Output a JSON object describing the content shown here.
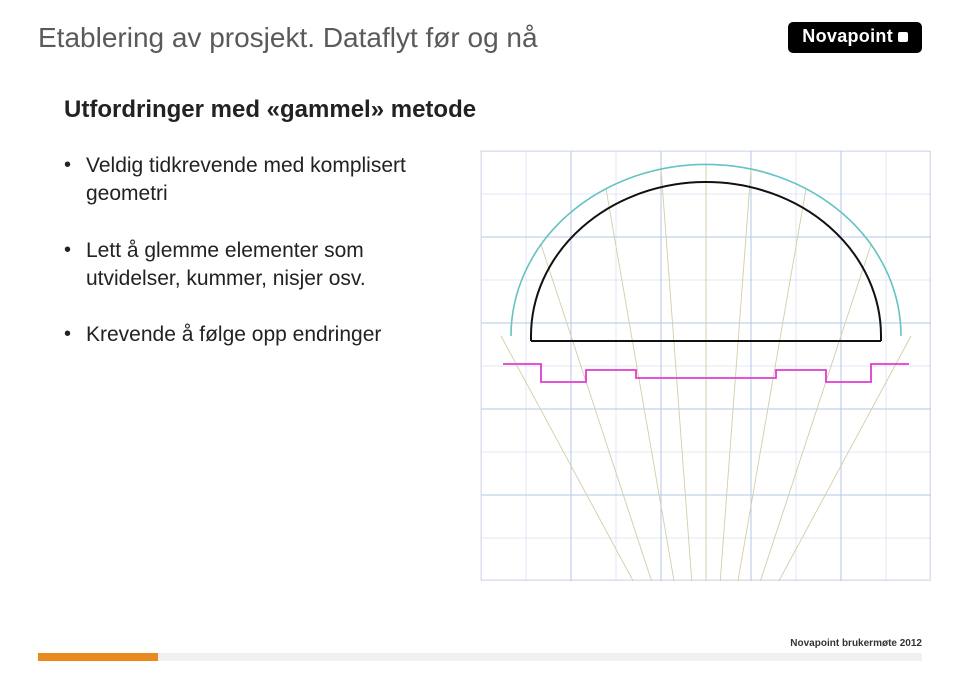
{
  "header": {
    "title": "Etablering av prosjekt. Dataflyt før og nå",
    "logo_text": "Novapoint"
  },
  "subtitle": "Utfordringer med «gammel» metode",
  "bullets": [
    "Veldig tidkrevende med komplisert geometri",
    "Lett å glemme elementer som utvidelser, kummer, nisjer osv.",
    "Krevende å følge opp endringer"
  ],
  "footer": {
    "text": "Novapoint brukermøte 2012"
  },
  "diagram": {
    "description": "tunnel-cross-section",
    "grid_color": "#b4c7e7",
    "arch_outer_color": "#66c2c2",
    "arch_inner_color": "#111",
    "base_profile_color": "#e23bd0",
    "radial_color": "#cfcfa8"
  }
}
